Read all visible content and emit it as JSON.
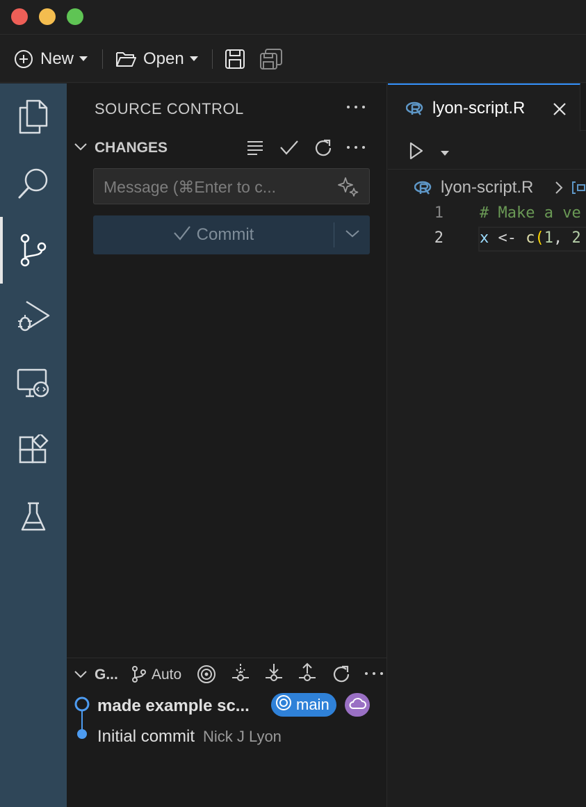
{
  "toolbar": {
    "new_label": "New",
    "open_label": "Open"
  },
  "activity_bar": {
    "items": [
      "explorer-icon",
      "search-icon",
      "source-control-icon",
      "run-debug-icon",
      "remote-explorer-icon",
      "extensions-icon",
      "testing-icon"
    ],
    "active": "source-control-icon"
  },
  "sidebar": {
    "title": "SOURCE CONTROL",
    "changes_label": "CHANGES",
    "message_placeholder": "Message (⌘Enter to c...",
    "commit_label": "Commit",
    "graph": {
      "label": "G...",
      "auto_label": "Auto",
      "commits": [
        {
          "message": "made example sc...",
          "branch": "main",
          "author": ""
        },
        {
          "message": "Initial commit",
          "branch": "",
          "author": "Nick J Lyon"
        }
      ]
    }
  },
  "editor": {
    "tab_label": "lyon-script.R",
    "breadcrumb_file": "lyon-script.R",
    "lines": [
      {
        "number": "1",
        "text": "# Make a ve"
      },
      {
        "number": "2",
        "text": "x <- c(1, 2"
      }
    ]
  },
  "colors": {
    "activity_bar": "#2f4658",
    "accent": "#3794ff",
    "branch_badge": "#2f81d8",
    "remote_badge": "#9a70c4",
    "commit_button": "#243545"
  }
}
